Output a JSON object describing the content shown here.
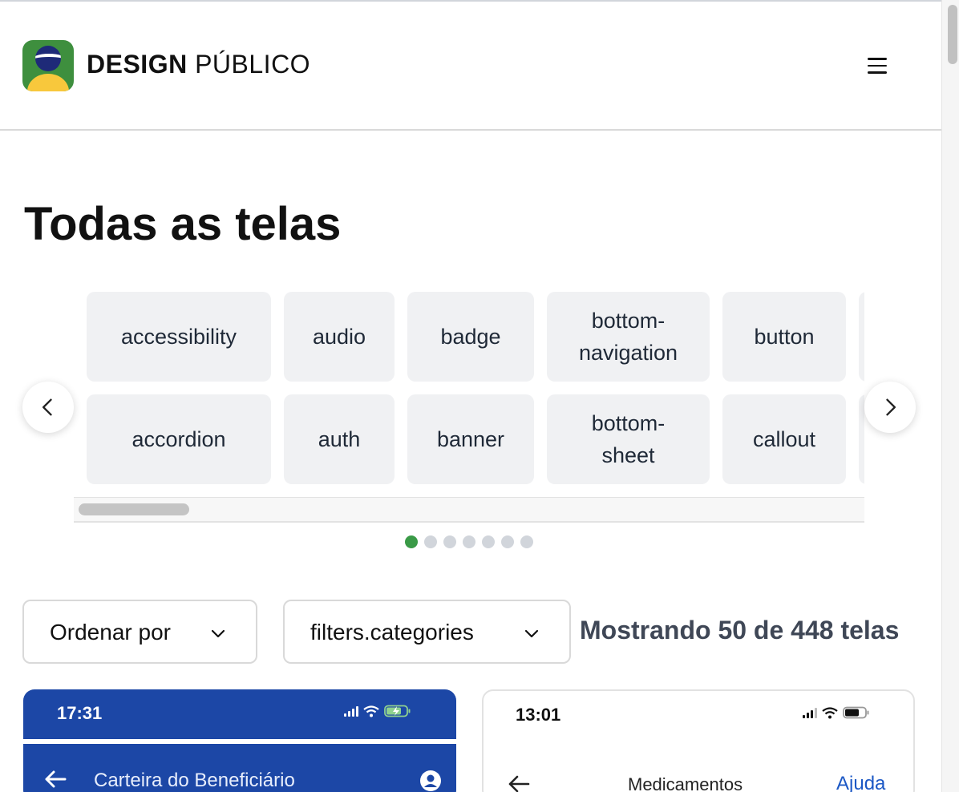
{
  "header": {
    "brand_bold": "DESIGN",
    "brand_light": "PÚBLICO",
    "logo_icon": "brazil-flag-logo-icon",
    "menu_icon": "hamburger-menu-icon"
  },
  "page_title": "Todas as telas",
  "carousel": {
    "row1": [
      "accessibility",
      "audio",
      "badge",
      "bottom-navigation",
      "button"
    ],
    "row2": [
      "accordion",
      "auth",
      "banner",
      "bottom-sheet",
      "callout"
    ],
    "prev_icon": "chevron-left-icon",
    "next_icon": "chevron-right-icon",
    "page_count": 7,
    "active_page": 1
  },
  "filters": {
    "sort_label": "Ordenar por",
    "category_label": "filters.categories",
    "result_text": "Mostrando 50 de 448 telas"
  },
  "cards": [
    {
      "time": "17:31",
      "title": "Carteira do Beneficiário",
      "back_icon": "arrow-left-icon",
      "right_icon": "user-circle-icon"
    },
    {
      "time": "13:01",
      "title": "Medicamentos",
      "action": "Ajuda",
      "back_icon": "arrow-left-icon"
    }
  ],
  "colors": {
    "accent_green": "#3a9a47",
    "card_blue": "#1c47a6",
    "link_blue": "#1c58c5",
    "chip_bg": "#f0f1f3"
  }
}
